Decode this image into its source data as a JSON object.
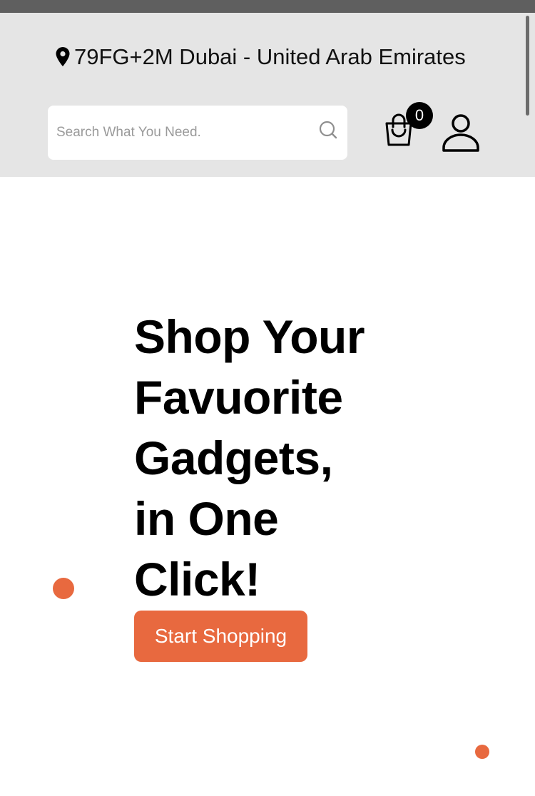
{
  "header": {
    "location": {
      "icon": "map-pin-icon",
      "text": "79FG+2M Dubai - United Arab Emirates"
    },
    "search": {
      "placeholder": "Search What You Need.",
      "value": "",
      "icon": "search-icon"
    },
    "cart": {
      "icon": "shopping-bag-icon",
      "count": "0"
    },
    "account": {
      "icon": "user-icon"
    }
  },
  "hero": {
    "title_lines": [
      "Shop Your",
      "Favuorite",
      "Gadgets,",
      "in One",
      "Click!"
    ],
    "cta_label": "Start Shopping"
  },
  "colors": {
    "header_bg": "#e5e5e5",
    "accent": "#e8693f",
    "decor_blue": "#5aa9ee",
    "badge_bg": "#000000"
  }
}
